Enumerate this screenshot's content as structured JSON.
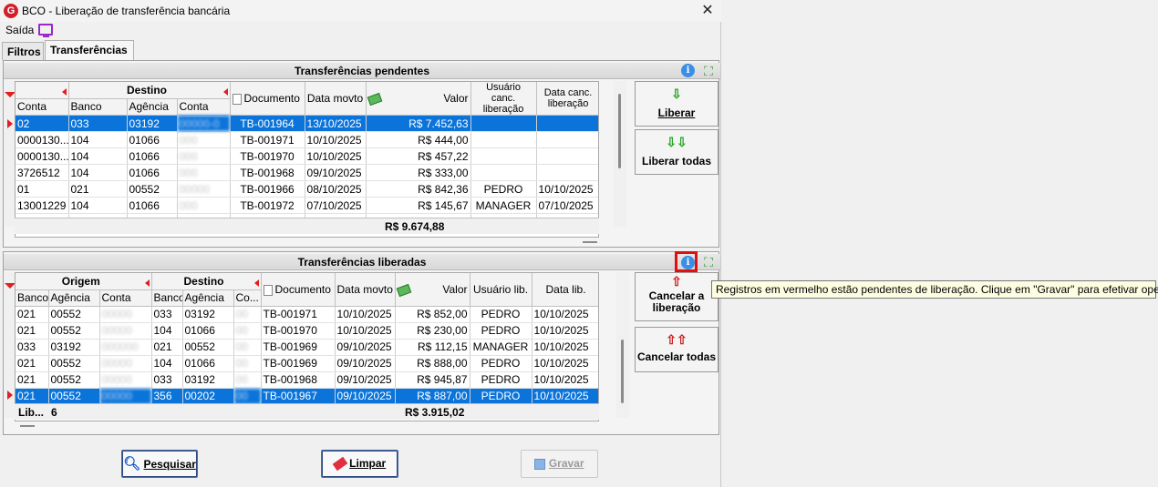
{
  "window": {
    "title": "BCO - Liberação de transferência bancária",
    "logo": "G"
  },
  "menu": {
    "saida": "Saída"
  },
  "tabs": [
    {
      "label": "Filtros"
    },
    {
      "label": "Transferências"
    }
  ],
  "pendentes": {
    "title": "Transferências pendentes",
    "group_headers": {
      "destino": "Destino"
    },
    "headers": {
      "conta": "Conta",
      "banco": "Banco",
      "agencia": "Agência",
      "conta2": "Conta",
      "documento": "Documento",
      "data_movto": "Data movto",
      "valor": "Valor",
      "usuario_canc": "Usuário canc. liberação",
      "data_canc": "Data canc. liberação"
    },
    "rows": [
      {
        "conta": "02",
        "banco": "033",
        "agencia": "03192",
        "conta2": "00000-0",
        "documento": "TB-001964",
        "data": "13/10/2025",
        "valor": "R$ 7.452,63",
        "usuario": "",
        "data_canc": ""
      },
      {
        "conta": "0000130...",
        "banco": "104",
        "agencia": "01066",
        "conta2": "000",
        "documento": "TB-001971",
        "data": "10/10/2025",
        "valor": "R$ 444,00",
        "usuario": "",
        "data_canc": ""
      },
      {
        "conta": "0000130...",
        "banco": "104",
        "agencia": "01066",
        "conta2": "000",
        "documento": "TB-001970",
        "data": "10/10/2025",
        "valor": "R$ 457,22",
        "usuario": "",
        "data_canc": ""
      },
      {
        "conta": "3726512",
        "banco": "104",
        "agencia": "01066",
        "conta2": "000",
        "documento": "TB-001968",
        "data": "09/10/2025",
        "valor": "R$ 333,00",
        "usuario": "",
        "data_canc": ""
      },
      {
        "conta": "01",
        "banco": "021",
        "agencia": "00552",
        "conta2": "00000",
        "documento": "TB-001966",
        "data": "08/10/2025",
        "valor": "R$ 842,36",
        "usuario": "PEDRO",
        "data_canc": "10/10/2025"
      },
      {
        "conta": "13001229",
        "banco": "104",
        "agencia": "01066",
        "conta2": "000",
        "documento": "TB-001972",
        "data": "07/10/2025",
        "valor": "R$ 145,67",
        "usuario": "MANAGER",
        "data_canc": "07/10/2025"
      }
    ],
    "total": "R$ 9.674,88"
  },
  "liberadas": {
    "title": "Transferências liberadas",
    "group_headers": {
      "origem": "Origem",
      "destino": "Destino"
    },
    "headers": {
      "banco": "Banco",
      "agencia": "Agência",
      "conta": "Conta",
      "banco2": "Banco",
      "agencia2": "Agência",
      "conta2": "Co...",
      "documento": "Documento",
      "data_movto": "Data movto",
      "valor": "Valor",
      "usuario_lib": "Usuário lib.",
      "data_lib": "Data lib."
    },
    "rows": [
      {
        "banco": "021",
        "agencia": "00552",
        "conta": "00000",
        "banco2": "033",
        "agencia2": "03192",
        "conta2": "00",
        "documento": "TB-001971",
        "data": "10/10/2025",
        "valor": "R$ 852,00",
        "usuario": "PEDRO",
        "data_lib": "10/10/2025"
      },
      {
        "banco": "021",
        "agencia": "00552",
        "conta": "00000",
        "banco2": "104",
        "agencia2": "01066",
        "conta2": "00",
        "documento": "TB-001970",
        "data": "10/10/2025",
        "valor": "R$ 230,00",
        "usuario": "PEDRO",
        "data_lib": "10/10/2025"
      },
      {
        "banco": "033",
        "agencia": "03192",
        "conta": "000000",
        "banco2": "021",
        "agencia2": "00552",
        "conta2": "00",
        "documento": "TB-001969",
        "data": "09/10/2025",
        "valor": "R$ 112,15",
        "usuario": "MANAGER",
        "data_lib": "10/10/2025"
      },
      {
        "banco": "021",
        "agencia": "00552",
        "conta": "00000",
        "banco2": "104",
        "agencia2": "01066",
        "conta2": "00",
        "documento": "TB-001969",
        "data": "09/10/2025",
        "valor": "R$ 888,00",
        "usuario": "PEDRO",
        "data_lib": "10/10/2025"
      },
      {
        "banco": "021",
        "agencia": "00552",
        "conta": "00000",
        "banco2": "033",
        "agencia2": "03192",
        "conta2": "00",
        "documento": "TB-001968",
        "data": "09/10/2025",
        "valor": "R$ 945,87",
        "usuario": "PEDRO",
        "data_lib": "10/10/2025"
      },
      {
        "banco": "021",
        "agencia": "00552",
        "conta": "00000",
        "banco2": "356",
        "agencia2": "00202",
        "conta2": "00",
        "documento": "TB-001967",
        "data": "09/10/2025",
        "valor": "R$ 887,00",
        "usuario": "PEDRO",
        "data_lib": "10/10/2025"
      }
    ],
    "footer_label": "Lib...",
    "footer_count": "6",
    "total": "R$ 3.915,02"
  },
  "buttons": {
    "liberar": "Liberar",
    "liberar_todas": "Liberar todas",
    "cancelar_liberacao": "Cancelar a liberação",
    "cancelar_todas": "Cancelar todas",
    "pesquisar": "Pesquisar",
    "limpar": "Limpar",
    "gravar": "Gravar"
  },
  "tooltip": "Registros em vermelho estão pendentes de liberação. Clique em \"Gravar\" para efetivar operação.",
  "colors": {
    "selection": "#0a74da",
    "highlight": "#e01010",
    "info": "#3a8ee6"
  }
}
